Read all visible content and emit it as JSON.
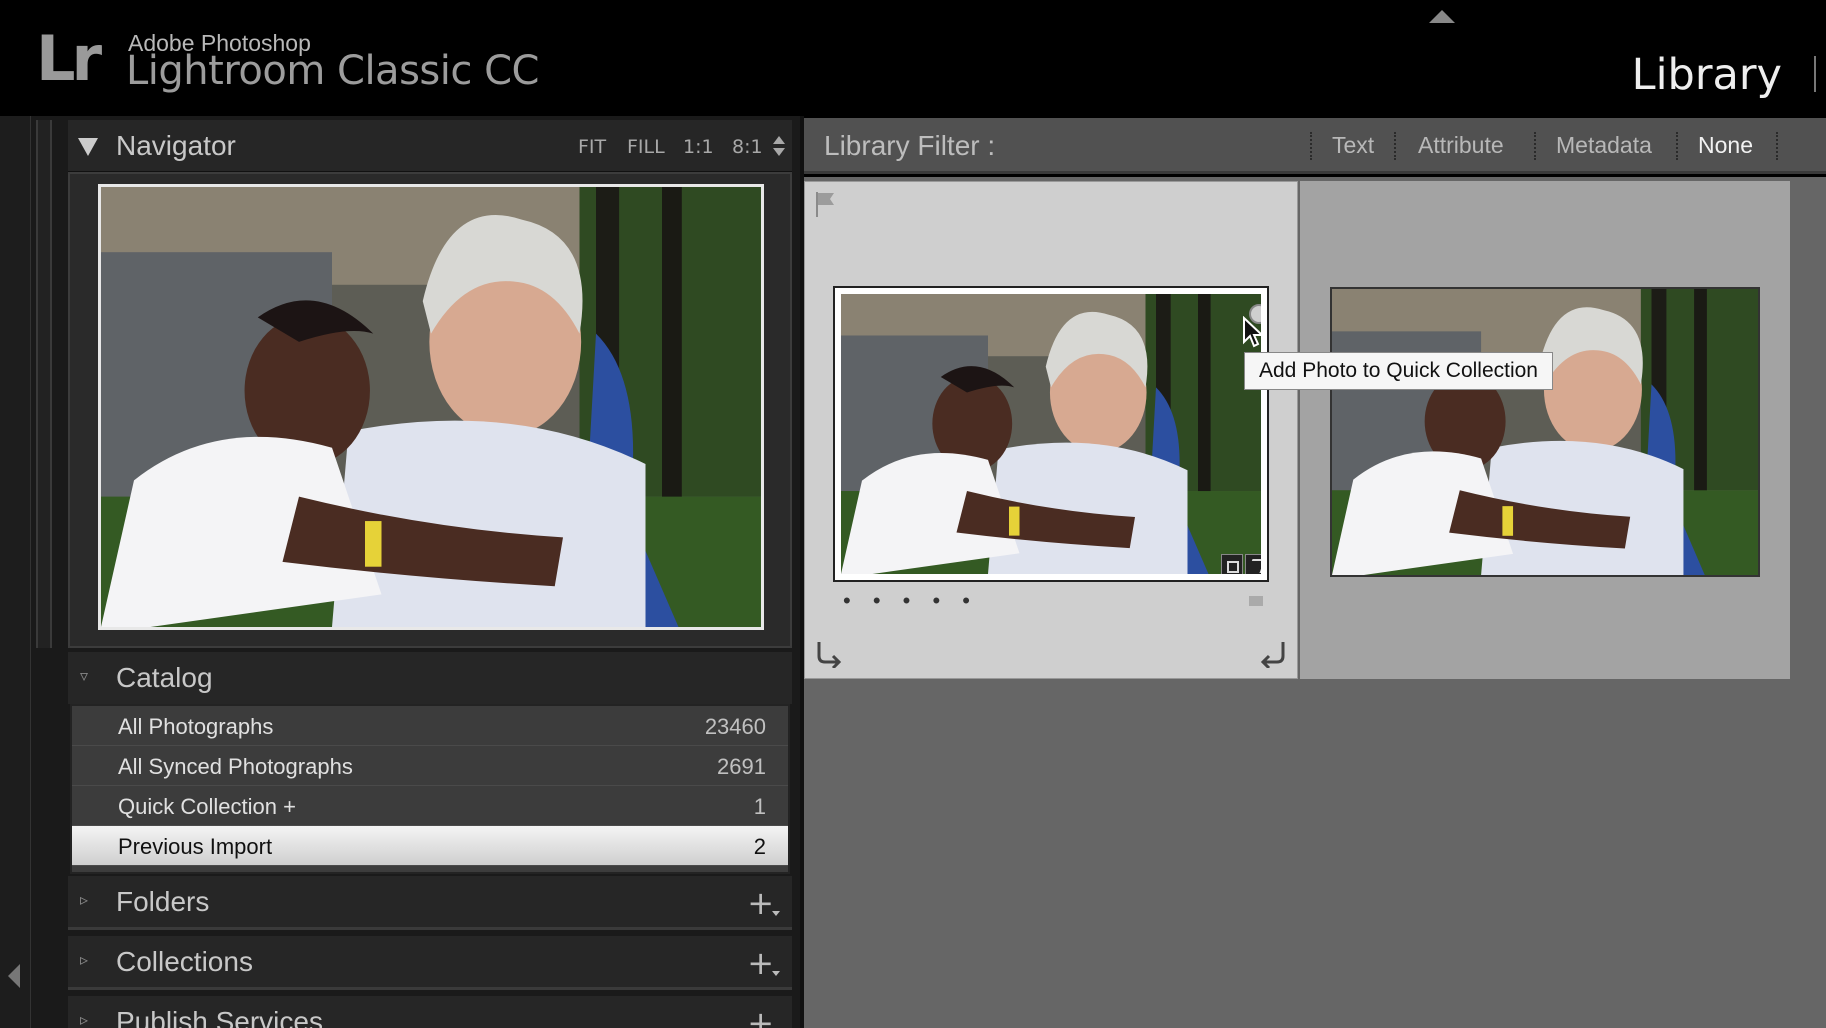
{
  "app": {
    "logo": "Lr",
    "brand_sub": "Adobe Photoshop",
    "brand_main": "Lightroom Classic CC",
    "module": "Library"
  },
  "navigator": {
    "title": "Navigator",
    "zoom": [
      "FIT",
      "FILL",
      "1:1",
      "8:1"
    ]
  },
  "catalog": {
    "title": "Catalog",
    "items": [
      {
        "label": "All Photographs",
        "count": "23460"
      },
      {
        "label": "All Synced Photographs",
        "count": "2691"
      },
      {
        "label": "Quick Collection  +",
        "count": "1"
      },
      {
        "label": "Previous Import",
        "count": "2"
      }
    ]
  },
  "panels": {
    "folders": "Folders",
    "collections": "Collections",
    "publish": "Publish Services"
  },
  "filter": {
    "label": "Library Filter :",
    "options": [
      "Text",
      "Attribute",
      "Metadata",
      "None"
    ],
    "active": "None"
  },
  "grid": {
    "rating_dots": "• • • • •",
    "tooltip": "Add Photo to Quick Collection"
  },
  "colors": {
    "background": "#000000",
    "panel": "#262626",
    "filter_bar": "#515151",
    "grid": "#666666",
    "selected_cell": "#cfcfcf"
  }
}
